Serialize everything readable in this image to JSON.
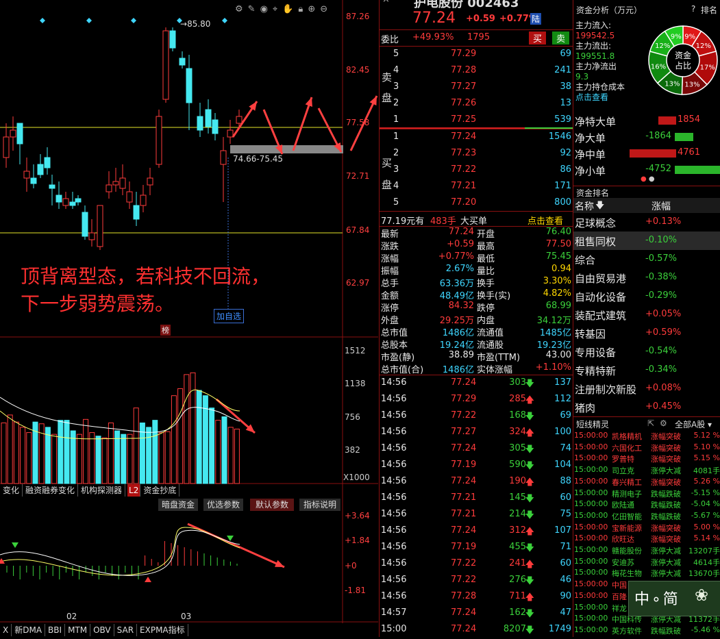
{
  "colors": {
    "up": "#ff3b3b",
    "down": "#3bd13b",
    "bar_cyan": "#45e8f0",
    "bg": "#000000",
    "grid": "#8a1010",
    "ma_yellow": "#ffff66"
  },
  "chart": {
    "price_axis": [
      "87.26",
      "82.45",
      "77.58",
      "72.71",
      "67.84",
      "62.97"
    ],
    "high_label": "85.80",
    "range_label": "74.66-75.45",
    "add_watch": "加自选",
    "rank_badge": "榜",
    "annotation_line1": "顶背离型态，若科技不回流，",
    "annotation_line2": "下一步弱势震荡。",
    "toolbar_icons": [
      "settings-icon",
      "pen-icon",
      "eye-icon",
      "pin-icon",
      "hand-icon",
      "lock-icon",
      "zoom-in-icon",
      "zoom-out-icon"
    ],
    "volume_axis": [
      "1512",
      "1138",
      "756",
      "382"
    ],
    "volume_unit": "X1000",
    "indicator_tabs": [
      "变化",
      "融资融券变化",
      "机构探测器",
      "L2",
      "资金抄底"
    ],
    "indicator_buttons": [
      "暗盘资金",
      "优选参数",
      "默认参数",
      "指标说明"
    ],
    "macd_axis": [
      "+3.64",
      "+1.84",
      "+0",
      "-1.81"
    ],
    "date_labels": [
      "02",
      "03"
    ],
    "bottom_tabs": [
      "X",
      "新DMA",
      "BBI",
      "MTM",
      "OBV",
      "SAR",
      "EXPMA指标"
    ],
    "volume_bars": [
      {
        "v": 690,
        "c": "red"
      },
      {
        "v": 780,
        "c": "red"
      },
      {
        "v": 700,
        "c": "red"
      },
      {
        "v": 640,
        "c": "red"
      },
      {
        "v": 580,
        "c": "red"
      },
      {
        "v": 700,
        "c": "cyan"
      },
      {
        "v": 680,
        "c": "red"
      },
      {
        "v": 640,
        "c": "cyan"
      },
      {
        "v": 560,
        "c": "red"
      },
      {
        "v": 720,
        "c": "cyan"
      },
      {
        "v": 720,
        "c": "cyan"
      },
      {
        "v": 600,
        "c": "cyan"
      },
      {
        "v": 560,
        "c": "red"
      },
      {
        "v": 730,
        "c": "red"
      },
      {
        "v": 580,
        "c": "red"
      },
      {
        "v": 540,
        "c": "cyan"
      },
      {
        "v": 520,
        "c": "red"
      },
      {
        "v": 690,
        "c": "red"
      },
      {
        "v": 600,
        "c": "cyan"
      },
      {
        "v": 560,
        "c": "cyan"
      },
      {
        "v": 560,
        "c": "red"
      },
      {
        "v": 860,
        "c": "red"
      },
      {
        "v": 690,
        "c": "cyan"
      },
      {
        "v": 640,
        "c": "cyan"
      },
      {
        "v": 720,
        "c": "cyan"
      },
      {
        "v": 580,
        "c": "red"
      },
      {
        "v": 590,
        "c": "red"
      },
      {
        "v": 1000,
        "c": "red"
      },
      {
        "v": 1080,
        "c": "red"
      },
      {
        "v": 1240,
        "c": "red"
      },
      {
        "v": 1260,
        "c": "red"
      },
      {
        "v": 1060,
        "c": "cyan"
      },
      {
        "v": 1000,
        "c": "cyan"
      },
      {
        "v": 860,
        "c": "cyan"
      },
      {
        "v": 720,
        "c": "red"
      },
      {
        "v": 760,
        "c": "cyan"
      },
      {
        "v": 640,
        "c": "red"
      },
      {
        "v": 620,
        "c": "red"
      }
    ]
  },
  "quote": {
    "title": "护电股份 002463",
    "price": "77.24",
    "change": "+0.59",
    "change_pct": "+0.77%",
    "market": "陆",
    "weibi_label": "委比",
    "weibi": "+49.93%",
    "weicha": "1795",
    "buy_btn": "买",
    "sell_btn": "卖",
    "sell_label": [
      "卖",
      "盘"
    ],
    "buy_label": [
      "买",
      "盘"
    ],
    "asks": [
      {
        "lvl": "5",
        "price": "77.29",
        "vol": "69"
      },
      {
        "lvl": "4",
        "price": "77.28",
        "vol": "241"
      },
      {
        "lvl": "3",
        "price": "77.27",
        "vol": "38"
      },
      {
        "lvl": "2",
        "price": "77.26",
        "vol": "13"
      },
      {
        "lvl": "1",
        "price": "77.25",
        "vol": "539"
      }
    ],
    "bids": [
      {
        "lvl": "1",
        "price": "77.24",
        "vol": "1546"
      },
      {
        "lvl": "2",
        "price": "77.23",
        "vol": "92"
      },
      {
        "lvl": "3",
        "price": "77.22",
        "vol": "86"
      },
      {
        "lvl": "4",
        "price": "77.21",
        "vol": "171"
      },
      {
        "lvl": "5",
        "price": "77.20",
        "vol": "800"
      }
    ],
    "big_order": {
      "price": "77.19元有",
      "qty": "483手",
      "label": "大买单",
      "link": "点击查看"
    },
    "stats": [
      {
        "l1": "最新",
        "v1": "77.24",
        "c1": "red",
        "l2": "开盘",
        "v2": "76.40",
        "c2": "green"
      },
      {
        "l1": "涨跌",
        "v1": "+0.59",
        "c1": "red",
        "l2": "最高",
        "v2": "77.50",
        "c2": "red"
      },
      {
        "l1": "涨幅",
        "v1": "+0.77%",
        "c1": "red",
        "l2": "最低",
        "v2": "75.45",
        "c2": "green"
      },
      {
        "l1": "振幅",
        "v1": "2.67%",
        "c1": "cyan",
        "l2": "量比",
        "v2": "0.94",
        "c2": "yellow"
      },
      {
        "l1": "总手",
        "v1": "63.36万",
        "c1": "cyan",
        "l2": "换手",
        "v2": "3.30%",
        "c2": "yellow"
      },
      {
        "l1": "金额",
        "v1": "48.49亿",
        "c1": "cyan",
        "l2": "换手(实)",
        "v2": "4.82%",
        "c2": "yellow"
      },
      {
        "l1": "涨停",
        "v1": "84.32",
        "c1": "red",
        "l2": "跌停",
        "v2": "68.99",
        "c2": "green"
      },
      {
        "l1": "外盘",
        "v1": "29.25万",
        "c1": "red",
        "l2": "内盘",
        "v2": "34.12万",
        "c2": "green"
      },
      {
        "l1": "总市值",
        "v1": "1486亿",
        "c1": "cyan",
        "l2": "流通值",
        "v2": "1485亿",
        "c2": "cyan"
      },
      {
        "l1": "总股本",
        "v1": "19.24亿",
        "c1": "cyan",
        "l2": "流通股",
        "v2": "19.23亿",
        "c2": "cyan"
      },
      {
        "l1": "市盈(静)",
        "v1": "38.89",
        "c1": "white",
        "l2": "市盈(TTM)",
        "v2": "43.00",
        "c2": "white"
      },
      {
        "l1": "总市值(合)",
        "v1": "1486亿",
        "c1": "cyan",
        "l2": "实体涨幅",
        "v2": "+1.10%",
        "c2": "red"
      }
    ],
    "trades": [
      {
        "t": "14:56",
        "p": "77.24",
        "v": "303",
        "d": "down",
        "n": "137"
      },
      {
        "t": "14:56",
        "p": "77.29",
        "v": "285",
        "d": "up",
        "n": "112"
      },
      {
        "t": "14:56",
        "p": "77.22",
        "v": "168",
        "d": "down",
        "n": "69"
      },
      {
        "t": "14:56",
        "p": "77.27",
        "v": "324",
        "d": "up",
        "n": "100"
      },
      {
        "t": "14:56",
        "p": "77.24",
        "v": "305",
        "d": "down",
        "n": "74"
      },
      {
        "t": "14:56",
        "p": "77.19",
        "v": "590",
        "d": "down",
        "n": "104"
      },
      {
        "t": "14:56",
        "p": "77.24",
        "v": "190",
        "d": "up",
        "n": "88"
      },
      {
        "t": "14:56",
        "p": "77.21",
        "v": "145",
        "d": "down",
        "n": "60"
      },
      {
        "t": "14:56",
        "p": "77.21",
        "v": "214",
        "d": "down",
        "n": "75"
      },
      {
        "t": "14:56",
        "p": "77.24",
        "v": "312",
        "d": "up",
        "n": "107"
      },
      {
        "t": "14:56",
        "p": "77.19",
        "v": "455",
        "d": "down",
        "n": "71"
      },
      {
        "t": "14:56",
        "p": "77.22",
        "v": "241",
        "d": "up",
        "n": "60"
      },
      {
        "t": "14:56",
        "p": "77.22",
        "v": "276",
        "d": "down",
        "n": "46"
      },
      {
        "t": "14:56",
        "p": "77.28",
        "v": "711",
        "d": "up",
        "n": "90"
      },
      {
        "t": "14:57",
        "p": "77.24",
        "v": "162",
        "d": "down",
        "n": "47"
      },
      {
        "t": "15:00",
        "p": "77.24",
        "v": "8207",
        "d": "down",
        "n": "1749"
      }
    ]
  },
  "side": {
    "fund_title": "资金分析（万元）",
    "help": "?",
    "rank": "排名",
    "inflow_label": "主力流入:",
    "inflow": "199542.5",
    "outflow_label": "主力流出:",
    "outflow": "199551.8",
    "net_label": "主力净流出",
    "net": "9.3",
    "cost_label": "主力持仓成本",
    "cost_link": "点击查看",
    "pie_center": [
      "资金",
      "占比"
    ],
    "pie": [
      {
        "pct": 9,
        "label": "9%",
        "color": "#e01818"
      },
      {
        "pct": 12,
        "label": "12%",
        "color": "#c01010"
      },
      {
        "pct": 17,
        "label": "17%",
        "color": "#b00a0a"
      },
      {
        "pct": 13,
        "label": "13%",
        "color": "#7a0808"
      },
      {
        "pct": 13,
        "label": "13%",
        "color": "#0a6a0a"
      },
      {
        "pct": 16,
        "label": "16%",
        "color": "#108a10"
      },
      {
        "pct": 12,
        "label": "12%",
        "color": "#18b018"
      },
      {
        "pct": 9,
        "label": "9%",
        "color": "#22cc22"
      }
    ],
    "flows": [
      {
        "label": "净特大单",
        "value": "1854",
        "dir": "pos",
        "mag": 1854
      },
      {
        "label": "净大单",
        "value": "-1864",
        "dir": "neg",
        "mag": 1864
      },
      {
        "label": "净中单",
        "value": "4761",
        "dir": "pos",
        "mag": 4761
      },
      {
        "label": "净小单",
        "value": "-4752",
        "dir": "neg",
        "mag": 4752
      }
    ],
    "rank_title": "资金排名",
    "rank_col1": "名称",
    "rank_col2": "涨幅",
    "rank_rows": [
      {
        "name": "足球概念",
        "pct": "+0.13%",
        "c": "red"
      },
      {
        "name": "租售同权",
        "pct": "-0.10%",
        "c": "green"
      },
      {
        "name": "综合",
        "pct": "-0.57%",
        "c": "green"
      },
      {
        "name": "自由贸易港",
        "pct": "-0.38%",
        "c": "green"
      },
      {
        "name": "自动化设备",
        "pct": "-0.29%",
        "c": "green"
      },
      {
        "name": "装配式建筑",
        "pct": "+0.05%",
        "c": "red"
      },
      {
        "name": "转基因",
        "pct": "+0.59%",
        "c": "red"
      },
      {
        "name": "专用设备",
        "pct": "-0.54%",
        "c": "green"
      },
      {
        "name": "专精特新",
        "pct": "-0.34%",
        "c": "green"
      },
      {
        "name": "注册制次新股",
        "pct": "+0.08%",
        "c": "red"
      },
      {
        "name": "猪肉",
        "pct": "+0.45%",
        "c": "red"
      }
    ],
    "short_title": "短线精灵",
    "short_filter": "全部A股",
    "short_rows": [
      {
        "t": "15:00:00",
        "n": "凯格精机",
        "e": "涨幅突破",
        "v": "5.12 %",
        "c": "red"
      },
      {
        "t": "15:00:00",
        "n": "六国化工",
        "e": "涨幅突破",
        "v": "5.10 %",
        "c": "red"
      },
      {
        "t": "15:00:00",
        "n": "罗普特",
        "e": "涨幅突破",
        "v": "5.15 %",
        "c": "red"
      },
      {
        "t": "15:00:00",
        "n": "司立克",
        "e": "涨停大减",
        "v": "4081手",
        "c": "green"
      },
      {
        "t": "15:00:00",
        "n": "春兴精工",
        "e": "涨幅突破",
        "v": "5.26 %",
        "c": "red"
      },
      {
        "t": "15:00:00",
        "n": "精测电子",
        "e": "跌幅跌破",
        "v": "-5.15 %",
        "c": "green"
      },
      {
        "t": "15:00:00",
        "n": "欧陆通",
        "e": "跌幅跌破",
        "v": "-5.04 %",
        "c": "green"
      },
      {
        "t": "15:00:00",
        "n": "亿田智能",
        "e": "跌幅跌破",
        "v": "-5.67 %",
        "c": "green"
      },
      {
        "t": "15:00:00",
        "n": "宝新能源",
        "e": "涨幅突破",
        "v": "5.00 %",
        "c": "red"
      },
      {
        "t": "15:00:00",
        "n": "欣旺达",
        "e": "涨幅突破",
        "v": "5.14 %",
        "c": "red"
      },
      {
        "t": "15:00:00",
        "n": "赣能股份",
        "e": "涨停大减",
        "v": "13207手",
        "c": "green"
      },
      {
        "t": "15:00:00",
        "n": "安迪苏",
        "e": "涨停大减",
        "v": "4614手",
        "c": "green"
      },
      {
        "t": "15:00:00",
        "n": "梅花生物",
        "e": "涨停大减",
        "v": "13670手",
        "c": "green"
      },
      {
        "t": "15:00:00",
        "n": "中国",
        "e": "",
        "v": "",
        "c": "red"
      },
      {
        "t": "15:00:00",
        "n": "百隆",
        "e": "",
        "v": "",
        "c": "red"
      },
      {
        "t": "15:00:00",
        "n": "祥龙",
        "e": "",
        "v": "",
        "c": "green"
      },
      {
        "t": "15:00:00",
        "n": "中国科传",
        "e": "涨停大减",
        "v": "11372手",
        "c": "green"
      },
      {
        "t": "15:00:00",
        "n": "英方软件",
        "e": "跌幅跌破",
        "v": "-5.46 %",
        "c": "green"
      }
    ],
    "watermark": "中 ∘ 简"
  }
}
